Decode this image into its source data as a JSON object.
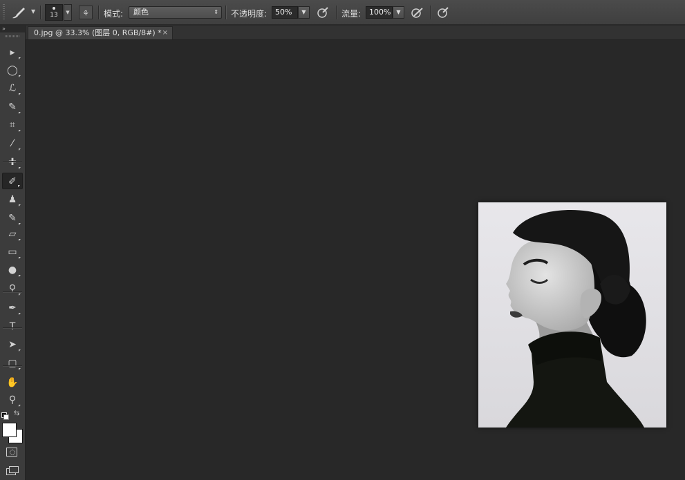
{
  "options_bar": {
    "brush_size": "13",
    "mode_label": "模式:",
    "mode_value": "颜色",
    "opacity_label": "不透明度:",
    "opacity_value": "50%",
    "flow_label": "流量:",
    "flow_value": "100%"
  },
  "document_tab": {
    "title": "0.jpg @ 33.3% (图层 0, RGB/8#) *",
    "close": "×"
  },
  "toolbox": {
    "collapse": "»",
    "tools": [
      {
        "name": "move-tool",
        "glyph": "▸"
      },
      {
        "name": "elliptical-marquee-tool",
        "glyph": "◯"
      },
      {
        "name": "lasso-tool",
        "glyph": "ℒ"
      },
      {
        "name": "quick-selection-tool",
        "glyph": "✎"
      },
      {
        "name": "crop-tool",
        "glyph": "⌗"
      },
      {
        "name": "eyedropper-tool",
        "glyph": "⁄"
      },
      {
        "name": "healing-brush-tool",
        "glyph": "✚"
      },
      {
        "name": "brush-tool",
        "glyph": "✐"
      },
      {
        "name": "clone-stamp-tool",
        "glyph": "♟"
      },
      {
        "name": "history-brush-tool",
        "glyph": "✎"
      },
      {
        "name": "eraser-tool",
        "glyph": "▱"
      },
      {
        "name": "gradient-tool",
        "glyph": "▭"
      },
      {
        "name": "blur-tool",
        "glyph": "●"
      },
      {
        "name": "dodge-tool",
        "glyph": "⚲"
      },
      {
        "name": "pen-tool",
        "glyph": "✒"
      },
      {
        "name": "type-tool",
        "glyph": "T"
      },
      {
        "name": "path-selection-tool",
        "glyph": "➤"
      },
      {
        "name": "rectangle-tool",
        "glyph": "▢"
      },
      {
        "name": "hand-tool",
        "glyph": "✋"
      },
      {
        "name": "zoom-tool",
        "glyph": "⚲"
      }
    ]
  },
  "colors": {
    "foreground": "#ffffff",
    "background": "#ffffff"
  }
}
